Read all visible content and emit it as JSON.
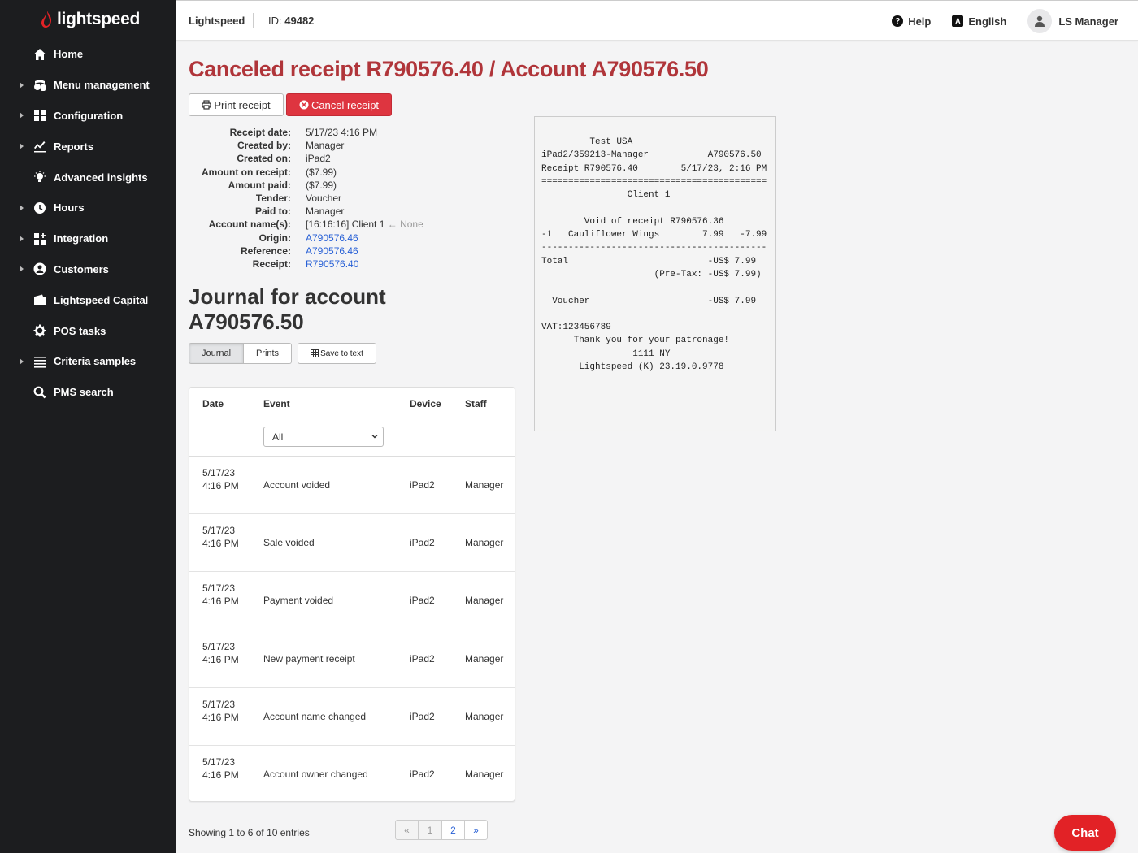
{
  "brand": {
    "logo_text": "lightspeed"
  },
  "sidebar": {
    "items": [
      {
        "label": "Home",
        "icon": "home-icon",
        "expandable": false
      },
      {
        "label": "Menu management",
        "icon": "menu-management-icon",
        "expandable": true
      },
      {
        "label": "Configuration",
        "icon": "configuration-icon",
        "expandable": true
      },
      {
        "label": "Reports",
        "icon": "reports-icon",
        "expandable": true
      },
      {
        "label": "Advanced insights",
        "icon": "lightbulb-icon",
        "expandable": false
      },
      {
        "label": "Hours",
        "icon": "clock-icon",
        "expandable": true
      },
      {
        "label": "Integration",
        "icon": "integration-icon",
        "expandable": true
      },
      {
        "label": "Customers",
        "icon": "customers-icon",
        "expandable": true
      },
      {
        "label": "Lightspeed Capital",
        "icon": "wallet-icon",
        "expandable": false
      },
      {
        "label": "POS tasks",
        "icon": "gear-icon",
        "expandable": false
      },
      {
        "label": "Criteria samples",
        "icon": "list-icon",
        "expandable": true
      },
      {
        "label": "PMS search",
        "icon": "search-icon",
        "expandable": false
      }
    ]
  },
  "topbar": {
    "brand": "Lightspeed",
    "id_label": "ID:",
    "id_value": "49482",
    "help": "Help",
    "language": "English",
    "user": "LS Manager"
  },
  "main": {
    "title": "Canceled receipt R790576.40 / Account A790576.50",
    "print_label": "Print receipt",
    "cancel_label": "Cancel receipt",
    "details": [
      {
        "label": "Receipt date:",
        "value": "5/17/23 4:16 PM"
      },
      {
        "label": "Created by:",
        "value": "Manager"
      },
      {
        "label": "Created on:",
        "value": "iPad2"
      },
      {
        "label": "Amount on receipt:",
        "value": "($7.99)"
      },
      {
        "label": "Amount paid:",
        "value": "($7.99)"
      },
      {
        "label": "Tender:",
        "value": "Voucher"
      },
      {
        "label": "Paid to:",
        "value": "Manager"
      }
    ],
    "account_name_label": "Account name(s):",
    "account_name_value": "[16:16:16] Client 1",
    "account_name_arrow": "←",
    "account_name_none": "None",
    "links": [
      {
        "label": "Origin:",
        "value": "A790576.46"
      },
      {
        "label": "Reference:",
        "value": "A790576.46"
      },
      {
        "label": "Receipt:",
        "value": "R790576.40"
      }
    ],
    "journal_title": "Journal for account A790576.50",
    "tab_journal": "Journal",
    "tab_prints": "Prints",
    "save_label": "Save to text"
  },
  "journal": {
    "headers": {
      "date": "Date",
      "event": "Event",
      "device": "Device",
      "staff": "Staff"
    },
    "event_filter": "All",
    "rows": [
      {
        "date": "5/17/23 4:16 PM",
        "event": "Account voided",
        "device": "iPad2",
        "staff": "Manager"
      },
      {
        "date": "5/17/23 4:16 PM",
        "event": "Sale voided",
        "device": "iPad2",
        "staff": "Manager"
      },
      {
        "date": "5/17/23 4:16 PM",
        "event": "Payment voided",
        "device": "iPad2",
        "staff": "Manager"
      },
      {
        "date": "5/17/23 4:16 PM",
        "event": "New payment receipt",
        "device": "iPad2",
        "staff": "Manager"
      },
      {
        "date": "5/17/23 4:16 PM",
        "event": "Account name changed",
        "device": "iPad2",
        "staff": "Manager"
      },
      {
        "date": "5/17/23 4:16 PM",
        "event": "Account owner changed",
        "device": "iPad2",
        "staff": "Manager"
      }
    ],
    "showing": "Showing 1 to 6 of 10 entries",
    "pager": {
      "prev": "«",
      "page1": "1",
      "page2": "2",
      "next": "»"
    }
  },
  "receipt_text": "         Test USA\niPad2/359213-Manager           A790576.50\nReceipt R790576.40        5/17/23, 2:16 PM\n==========================================\n                Client 1\n\n        Void of receipt R790576.36\n-1   Cauliflower Wings        7.99   -7.99\n------------------------------------------\nTotal                          -US$ 7.99\n                     (Pre-Tax: -US$ 7.99)\n\n  Voucher                      -US$ 7.99\n\nVAT:123456789\n      Thank you for your patronage!\n                 1111 NY\n       Lightspeed (K) 23.19.0.9778",
  "chat": {
    "label": "Chat"
  },
  "colors": {
    "title_red": "#b0353a",
    "cancel_red": "#de3540",
    "link_blue": "#2961d6",
    "sidebar_bg": "#1c1d1f",
    "chat_red": "#e22226"
  }
}
